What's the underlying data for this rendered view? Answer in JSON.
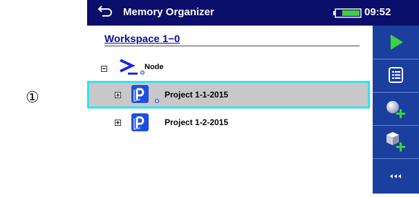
{
  "callout": "①",
  "header": {
    "title": "Memory Organizer",
    "time": "09:52",
    "back_icon": "back-arrow-icon",
    "battery_icon": "battery-icon"
  },
  "workspace": {
    "name": "Workspace 1−0"
  },
  "tree": {
    "node": {
      "label": "Node",
      "icon": "node-prompt-icon",
      "expander": "collapse"
    },
    "items": [
      {
        "label": "Project 1-1-2015",
        "icon": "project-icon",
        "expander": "expand",
        "selected": true
      },
      {
        "label": "Project 1-2-2015",
        "icon": "project-icon",
        "expander": "expand",
        "selected": false
      }
    ]
  },
  "sidebar": {
    "buttons": [
      {
        "icon": "play-icon"
      },
      {
        "icon": "list-icon"
      },
      {
        "icon": "add-measurement-icon"
      },
      {
        "icon": "add-object-icon"
      },
      {
        "icon": "collapse-left-icon"
      }
    ]
  },
  "colors": {
    "header_bg": "#0a0f6b",
    "sidebar_bg": "#1b3f9e",
    "accent_green": "#3fd23f",
    "selection_border": "#33e0f0",
    "selection_bg": "#c8c8c8",
    "link_blue": "#0a0f9e"
  }
}
